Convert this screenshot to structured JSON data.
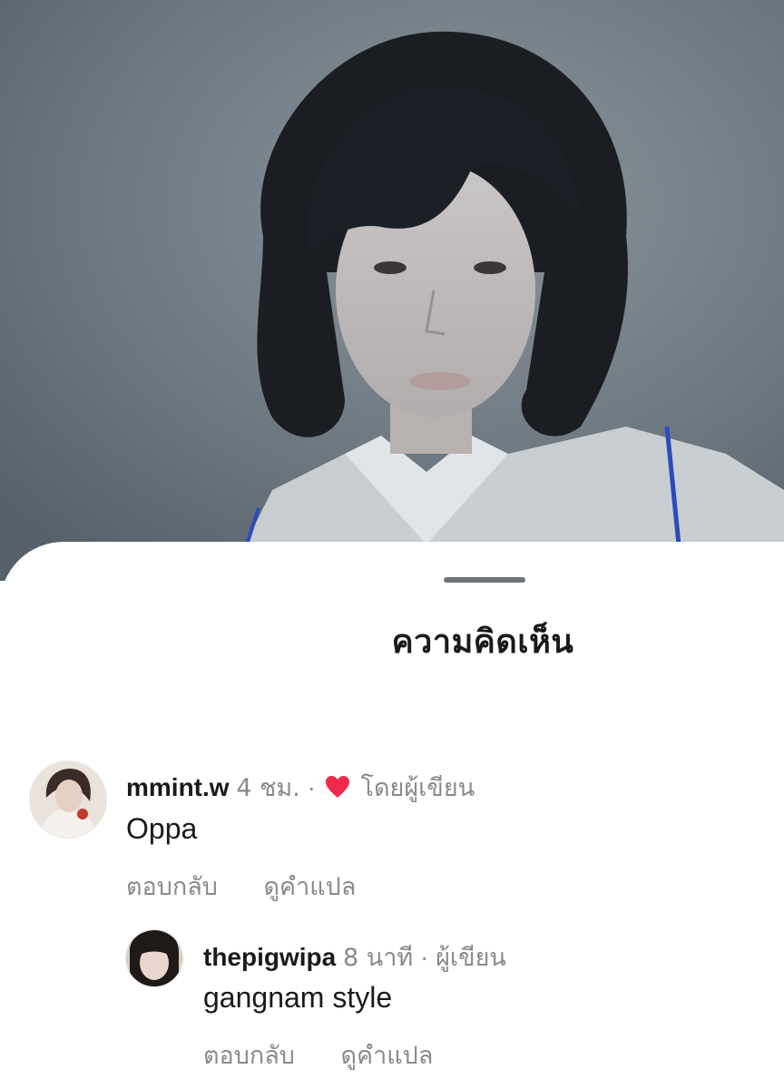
{
  "sheet": {
    "title": "ความคิดเห็น"
  },
  "comments": [
    {
      "username": "mmint.w",
      "time": "4 ชม.",
      "separator": "·",
      "liked_by_author": true,
      "liked_label": "โดยผู้เขียน",
      "text": "Oppa",
      "reply_label": "ตอบกลับ",
      "translate_label": "ดูคำแปล"
    },
    {
      "username": "thepigwipa",
      "time": "8 นาที",
      "separator": "·",
      "author_label": "ผู้เขียน",
      "text": "gangnam style",
      "reply_label": "ตอบกลับ",
      "translate_label": "ดูคำแปล"
    }
  ],
  "colors": {
    "heart": "#ef2b4d",
    "secondary_text": "#8a8a8a",
    "primary_text": "#1a1a1a",
    "grabber": "#6e737a"
  },
  "icons": {
    "like": "heart-icon"
  }
}
